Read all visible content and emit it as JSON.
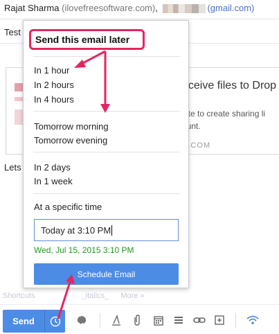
{
  "compose": {
    "from_name": "Rajat Sharma",
    "from_email": "(ilovefreesoftware.com)",
    "separator": ",",
    "gmail_suffix": "(gmail.com)",
    "subject": "Test",
    "body_text": "Lets"
  },
  "card": {
    "title": "eceive files to Drop",
    "desc_line1": "site to create sharing li",
    "desc_line2": "ount.",
    "domain": "E.COM"
  },
  "formatting_bar": {
    "shortcuts": "Shortcuts",
    "extra1": "_italics_",
    "more": "More »"
  },
  "toolbar": {
    "send_label": "Send",
    "icons": [
      "schedule-clock-icon",
      "drive-smiley-icon",
      "format-text-icon",
      "attachment-icon",
      "calendar-icon",
      "list-icon",
      "link-icon",
      "insert-plus-icon",
      "wifi-icon"
    ]
  },
  "popup": {
    "title": "Send this email later",
    "options_group1": [
      "In 1 hour",
      "In 2 hours",
      "In 4 hours"
    ],
    "options_group2": [
      "Tomorrow morning",
      "Tomorrow evening"
    ],
    "options_group3": [
      "In 2 days",
      "In 1 week"
    ],
    "specific_time_label": "At a specific time",
    "time_input_value": "Today at 3:10 PM",
    "date_preview": "Wed, Jul 15, 2015 3:10 PM",
    "schedule_button": "Schedule Email"
  },
  "colors": {
    "accent_blue": "#4d8ce5",
    "annotation_pink": "#e8245f",
    "preview_green": "#1e9b1e"
  }
}
